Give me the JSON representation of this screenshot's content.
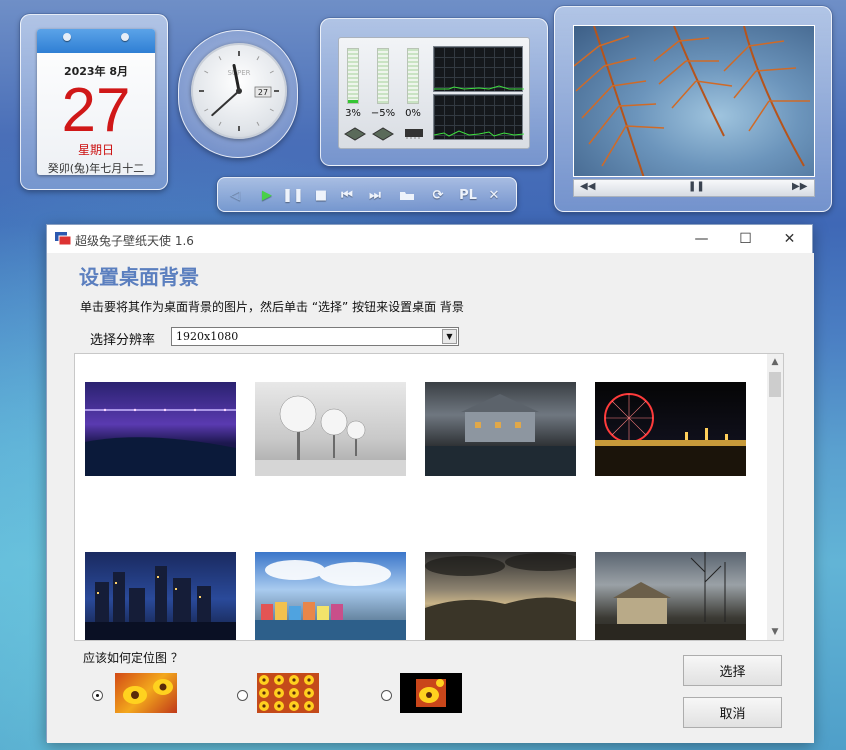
{
  "calendar": {
    "year_month": "2023年 8月",
    "day": "27",
    "weekday": "星期日",
    "lunar": "癸卯(兔)年七月十二"
  },
  "clock": {
    "date_window": "27",
    "hour": 11,
    "minute": 38
  },
  "monitor": {
    "cpu1_percent": "3%",
    "cpu2_percent": "−5%",
    "mem_percent": "0%",
    "cpu1_level": 0.03,
    "cpu2_level": 0.0,
    "mem_level": 0.0
  },
  "media_bar": {
    "playlist_label": "PL",
    "icons": [
      "back-icon",
      "play-icon",
      "pause-icon",
      "stop-icon",
      "previous-icon",
      "next-icon",
      "open-folder-icon",
      "repeat-icon",
      "playlist-icon",
      "close-icon"
    ]
  },
  "slideshow": {
    "icons": [
      "previous-icon",
      "pause-icon",
      "next-icon"
    ]
  },
  "window": {
    "title": "超级兔子壁纸天使 1.6",
    "heading": "设置桌面背景",
    "instruction": "单击要将其作为桌面背景的图片，然后单击 “选择” 按钮来设置桌面 背景",
    "resolution_label": "选择分辨率",
    "resolution_value": "1920x1080",
    "position_label": "应该如何定位图 ？",
    "position_options": [
      "拉伸",
      "平铺",
      "居中"
    ],
    "selected_position": 0,
    "select_button": "选择",
    "cancel_button": "取消",
    "thumbnails": [
      "night-bridge",
      "frosted-trees",
      "harbor-house",
      "ferris-wheel",
      "city-skyline",
      "colorful-harbor",
      "hills-clouds",
      "old-house"
    ]
  },
  "colors": {
    "heading": "#5b7fbf",
    "calendar_red": "#d01818",
    "meter_green": "#34c634"
  }
}
